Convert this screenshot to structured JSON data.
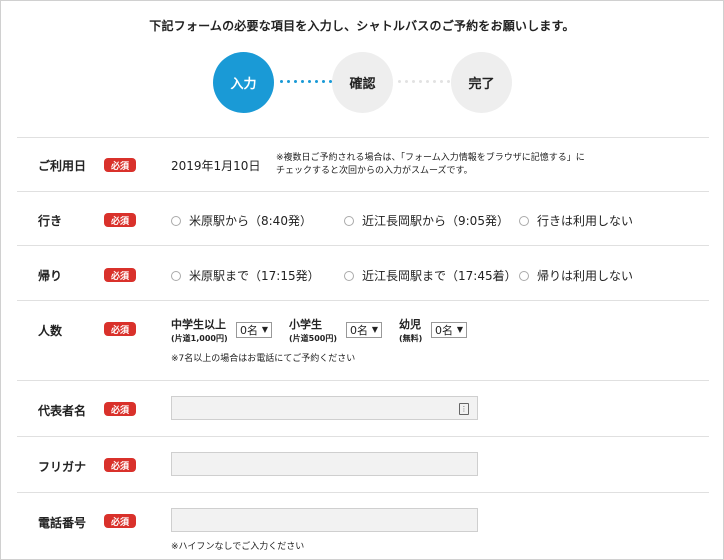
{
  "intro": "下記フォームの必要な項目を入力し、シャトルバスのご予約をお願いします。",
  "steps": [
    "入力",
    "確認",
    "完了"
  ],
  "required_label": "必須",
  "date": {
    "label": "ご利用日",
    "value": "2019年1月10日",
    "note_line1": "※複数日ご予約される場合は、「フォーム入力情報をブラウザに記憶する」に",
    "note_line2": "チェックすると次回からの入力がスムーズです。"
  },
  "outbound": {
    "label": "行き",
    "options": [
      "米原駅から（8:40発）",
      "近江長岡駅から（9:05発）",
      "行きは利用しない"
    ]
  },
  "return": {
    "label": "帰り",
    "options": [
      "米原駅まで（17:15発）",
      "近江長岡駅まで（17:45着）",
      "帰りは利用しない"
    ]
  },
  "people": {
    "label": "人数",
    "groups": [
      {
        "name": "中学生以上",
        "sub": "(片道1,000円)",
        "value": "0名"
      },
      {
        "name": "小学生",
        "sub": "(片道500円)",
        "value": "0名"
      },
      {
        "name": "幼児",
        "sub": "(無料)",
        "value": "0名"
      }
    ],
    "note": "※7名以上の場合はお電話にてご予約ください"
  },
  "representative": {
    "label": "代表者名",
    "value": ""
  },
  "furigana": {
    "label": "フリガナ",
    "value": ""
  },
  "phone": {
    "label": "電話番号",
    "value": "",
    "note": "※ハイフンなしでご入力ください"
  },
  "colors": {
    "accent": "#1a9ad6",
    "required": "#d9312b",
    "step_inactive": "#eeeeee"
  }
}
